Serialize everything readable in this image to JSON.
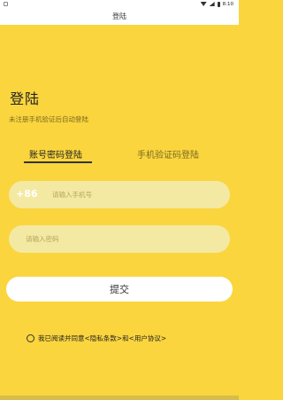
{
  "status_bar": {
    "time": "8:10"
  },
  "title_bar": {
    "title": "登陆"
  },
  "heading": {
    "title": "登陆",
    "subtitle": "未注册手机验证后自动登陆"
  },
  "tabs": [
    {
      "label": "账号密码登陆",
      "active": true
    },
    {
      "label": "手机验证码登陆",
      "active": false
    }
  ],
  "phone_field": {
    "country_code": "+86",
    "placeholder": "请输入手机号"
  },
  "password_field": {
    "placeholder": "请输入密码"
  },
  "submit_button": {
    "label": "提交"
  },
  "agreement": {
    "text": "我已阅读并同意<隐私条款>和<用户协议>",
    "checked": false
  },
  "colors": {
    "background": "#fad53e",
    "field": "#f3e9a3",
    "button": "#ffffff"
  }
}
